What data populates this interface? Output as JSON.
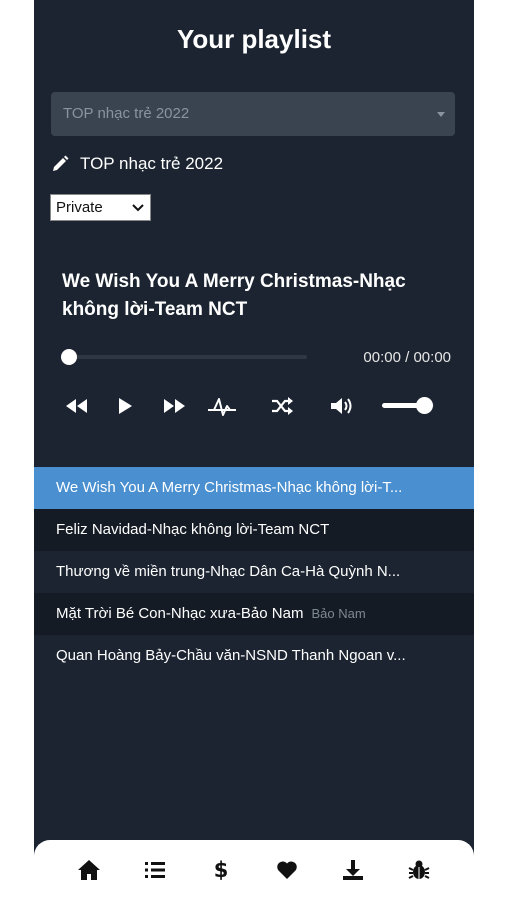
{
  "header": {
    "title": "Your playlist"
  },
  "playlist_select": {
    "value": "TOP nhạc trẻ 2022"
  },
  "playlist_name": "TOP nhạc trẻ 2022",
  "privacy": {
    "value": "Private"
  },
  "player": {
    "song_title": "We Wish You A Merry Christmas-Nhạc không lời-Team NCT",
    "time": "00:00 / 00:00",
    "progress": 0.0,
    "volume": 0.8
  },
  "tracks": [
    {
      "title": "We Wish You A Merry Christmas-Nhạc không lời-T...",
      "artist": "",
      "active": true
    },
    {
      "title": "Feliz Navidad-Nhạc không lời-Team NCT",
      "artist": "",
      "active": false
    },
    {
      "title": "Thương về miền trung-Nhạc Dân Ca-Hà Quỳnh N...",
      "artist": "",
      "active": false
    },
    {
      "title": "Mặt Trời Bé Con-Nhạc xưa-Bảo Nam",
      "artist": "Bảo Nam",
      "active": false
    },
    {
      "title": "Quan Hoàng Bảy-Chầu văn-NSND Thanh Ngoan v...",
      "artist": "",
      "active": false
    }
  ],
  "icons": {
    "edit": "pencil-icon",
    "controls": [
      "rewind-icon",
      "play-icon",
      "fast-forward-icon",
      "equalizer-icon",
      "shuffle-icon",
      "volume-icon"
    ],
    "nav": [
      "home-icon",
      "list-icon",
      "dollar-icon",
      "heart-icon",
      "download-icon",
      "bug-icon"
    ]
  },
  "colors": {
    "background": "#1b2430",
    "active_track": "#4a8fd0",
    "select_bg": "#3a4450"
  }
}
